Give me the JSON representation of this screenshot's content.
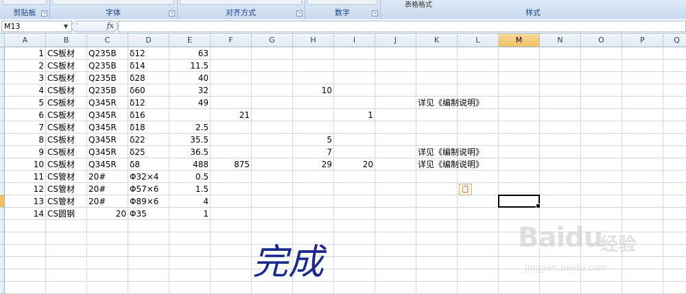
{
  "ribbon": {
    "groups": [
      {
        "label": "剪贴板"
      },
      {
        "label": "字体"
      },
      {
        "label": "对齐方式"
      },
      {
        "label": "数字"
      },
      {
        "label": "样式"
      }
    ],
    "partial_title": "表格格式"
  },
  "formula_bar": {
    "name_box": "M13",
    "fx_label": "fx",
    "formula": ""
  },
  "columns": [
    "A",
    "B",
    "C",
    "D",
    "E",
    "F",
    "G",
    "H",
    "I",
    "J",
    "K",
    "L",
    "M",
    "N",
    "O",
    "P",
    "Q"
  ],
  "selected_column": "M",
  "selected_cell": "M13",
  "rows": [
    {
      "A": "1",
      "B": "CS板材",
      "C": "Q235B",
      "D": "δ12",
      "E": "63"
    },
    {
      "A": "2",
      "B": "CS板材",
      "C": "Q235B",
      "D": "δ14",
      "E": "11.5"
    },
    {
      "A": "3",
      "B": "CS板材",
      "C": "Q235B",
      "D": "δ28",
      "E": "40"
    },
    {
      "A": "4",
      "B": "CS板材",
      "C": "Q235B",
      "D": "δ60",
      "E": "32",
      "H": "10"
    },
    {
      "A": "5",
      "B": "CS板材",
      "C": "Q345R",
      "D": "δ12",
      "E": "49",
      "K": "详见《编制说明》"
    },
    {
      "A": "6",
      "B": "CS板材",
      "C": "Q345R",
      "D": "δ16",
      "F": "21",
      "I": "1"
    },
    {
      "A": "7",
      "B": "CS板材",
      "C": "Q345R",
      "D": "δ18",
      "E": "2.5"
    },
    {
      "A": "8",
      "B": "CS板材",
      "C": "Q345R",
      "D": "δ22",
      "E": "35.5",
      "H": "5"
    },
    {
      "A": "9",
      "B": "CS板材",
      "C": "Q345R",
      "D": "δ25",
      "E": "36.5",
      "H": "7",
      "K": "详见《编制说明》"
    },
    {
      "A": "10",
      "B": "CS板材",
      "C": "Q345R",
      "D": "δ8",
      "E": "488",
      "F": "875",
      "H": "29",
      "I": "20",
      "K": "详见《编制说明》"
    },
    {
      "A": "11",
      "B": "CS管材",
      "C": "20#",
      "D": "Φ32×4",
      "E": "0.5"
    },
    {
      "A": "12",
      "B": "CS管材",
      "C": "20#",
      "D": "Φ57×6",
      "E": "1.5"
    },
    {
      "A": "13",
      "B": "CS管材",
      "C": "20#",
      "D": "Φ89×6",
      "E": "4"
    },
    {
      "A": "14",
      "B": "CS圆钢",
      "C": "20",
      "D": "Φ35",
      "E": "1"
    }
  ],
  "annotation": {
    "handwritten": "完成"
  },
  "watermark": {
    "logo": "Baidu",
    "cn": "经验",
    "url": "jingyan.baidu.com"
  },
  "colors": {
    "selection_header": "#f1c15f",
    "grid_line": "#d0d7e5",
    "handwriting": "#1a2a8c"
  }
}
